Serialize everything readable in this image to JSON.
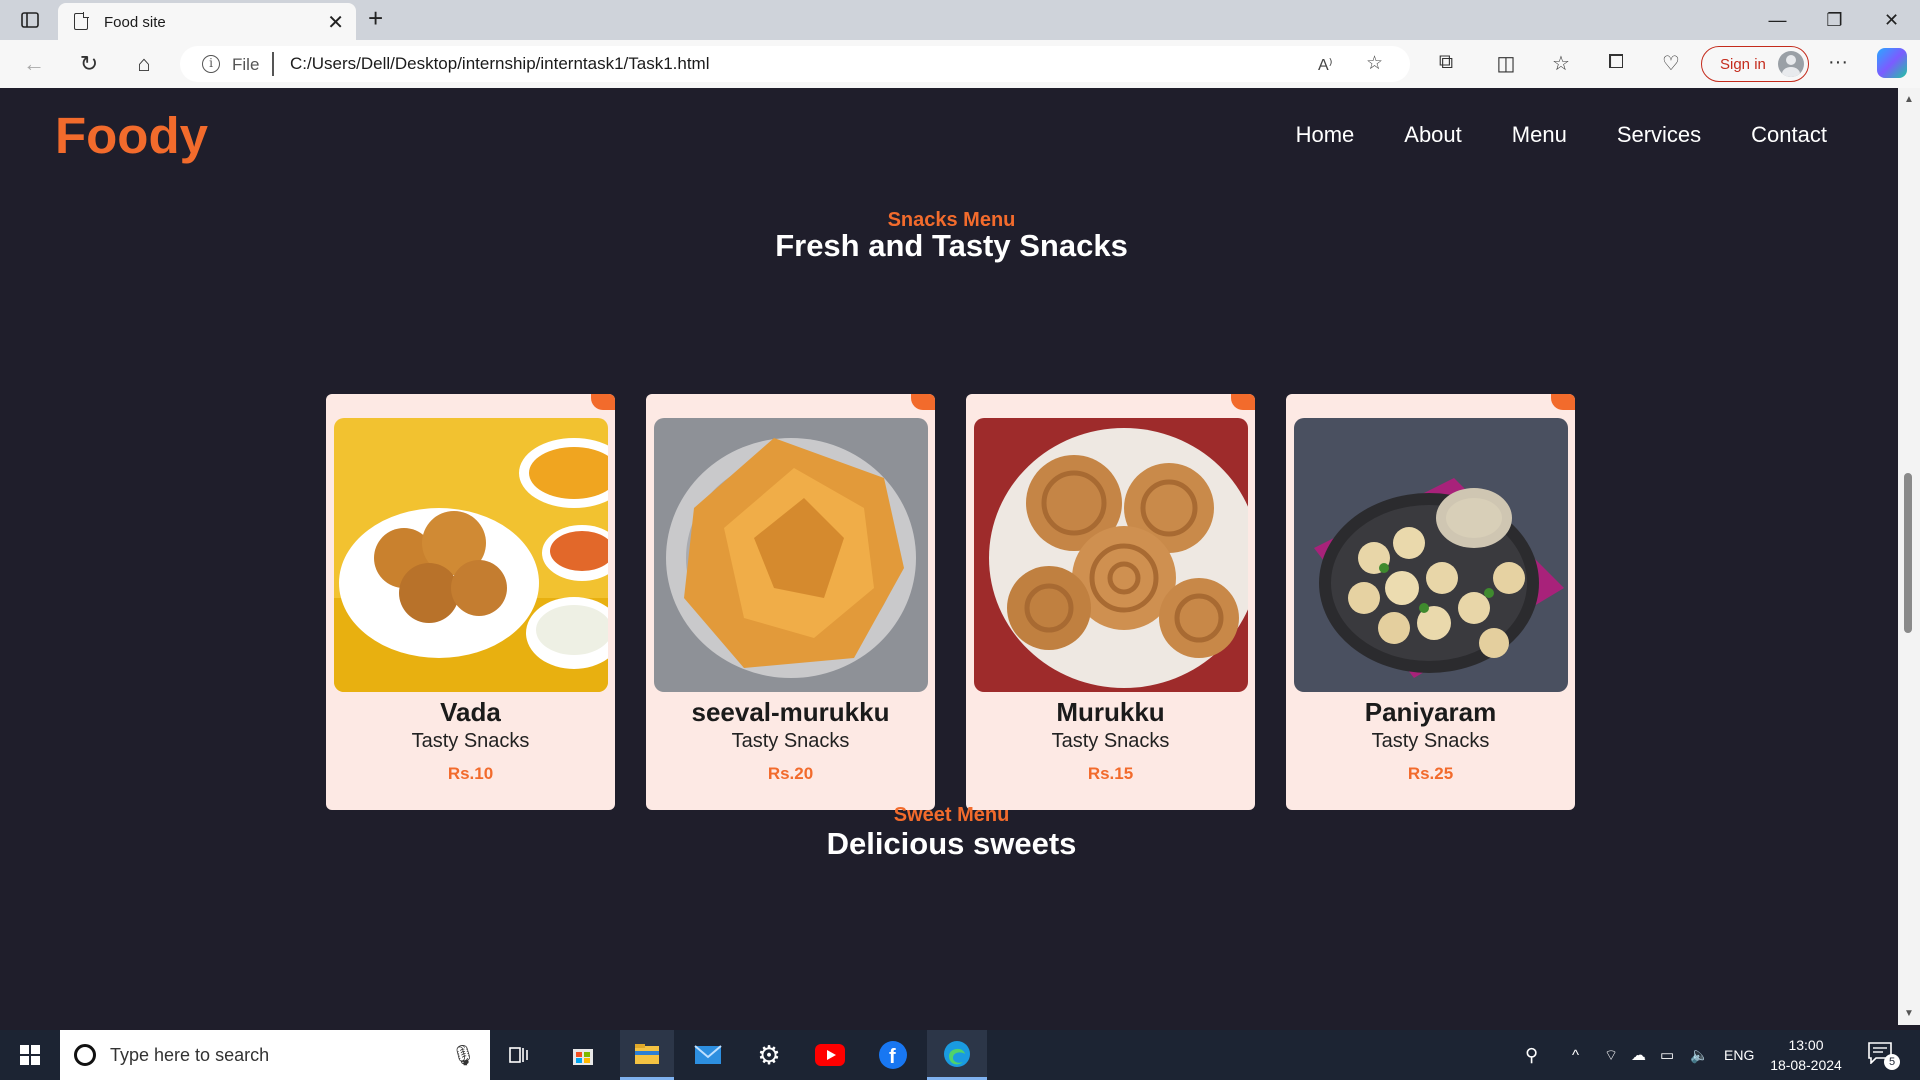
{
  "browser": {
    "tab_title": "Food site",
    "address_scheme": "File",
    "address_url": "C:/Users/Dell/Desktop/internship/interntask1/Task1.html",
    "signin_label": "Sign in"
  },
  "site": {
    "logo": "Foody",
    "nav": [
      "Home",
      "About",
      "Menu",
      "Services",
      "Contact"
    ]
  },
  "snacks": {
    "subtitle": "Snacks Menu",
    "title": "Fresh and Tasty Snacks",
    "items": [
      {
        "name": "Vada",
        "desc": "Tasty Snacks",
        "price": "Rs.10"
      },
      {
        "name": "seeval-murukku",
        "desc": "Tasty Snacks",
        "price": "Rs.20"
      },
      {
        "name": "Murukku",
        "desc": "Tasty Snacks",
        "price": "Rs.15"
      },
      {
        "name": "Paniyaram",
        "desc": "Tasty Snacks",
        "price": "Rs.25"
      }
    ]
  },
  "sweets": {
    "subtitle": "Sweet Menu",
    "title": "Delicious sweets"
  },
  "taskbar": {
    "search_placeholder": "Type here to search",
    "language": "ENG",
    "time": "13:00",
    "date": "18-08-2024",
    "notification_count": "5"
  },
  "colors": {
    "accent": "#f26b2c",
    "page_bg": "#1f1e2b",
    "card_bg": "#fde9e4"
  }
}
